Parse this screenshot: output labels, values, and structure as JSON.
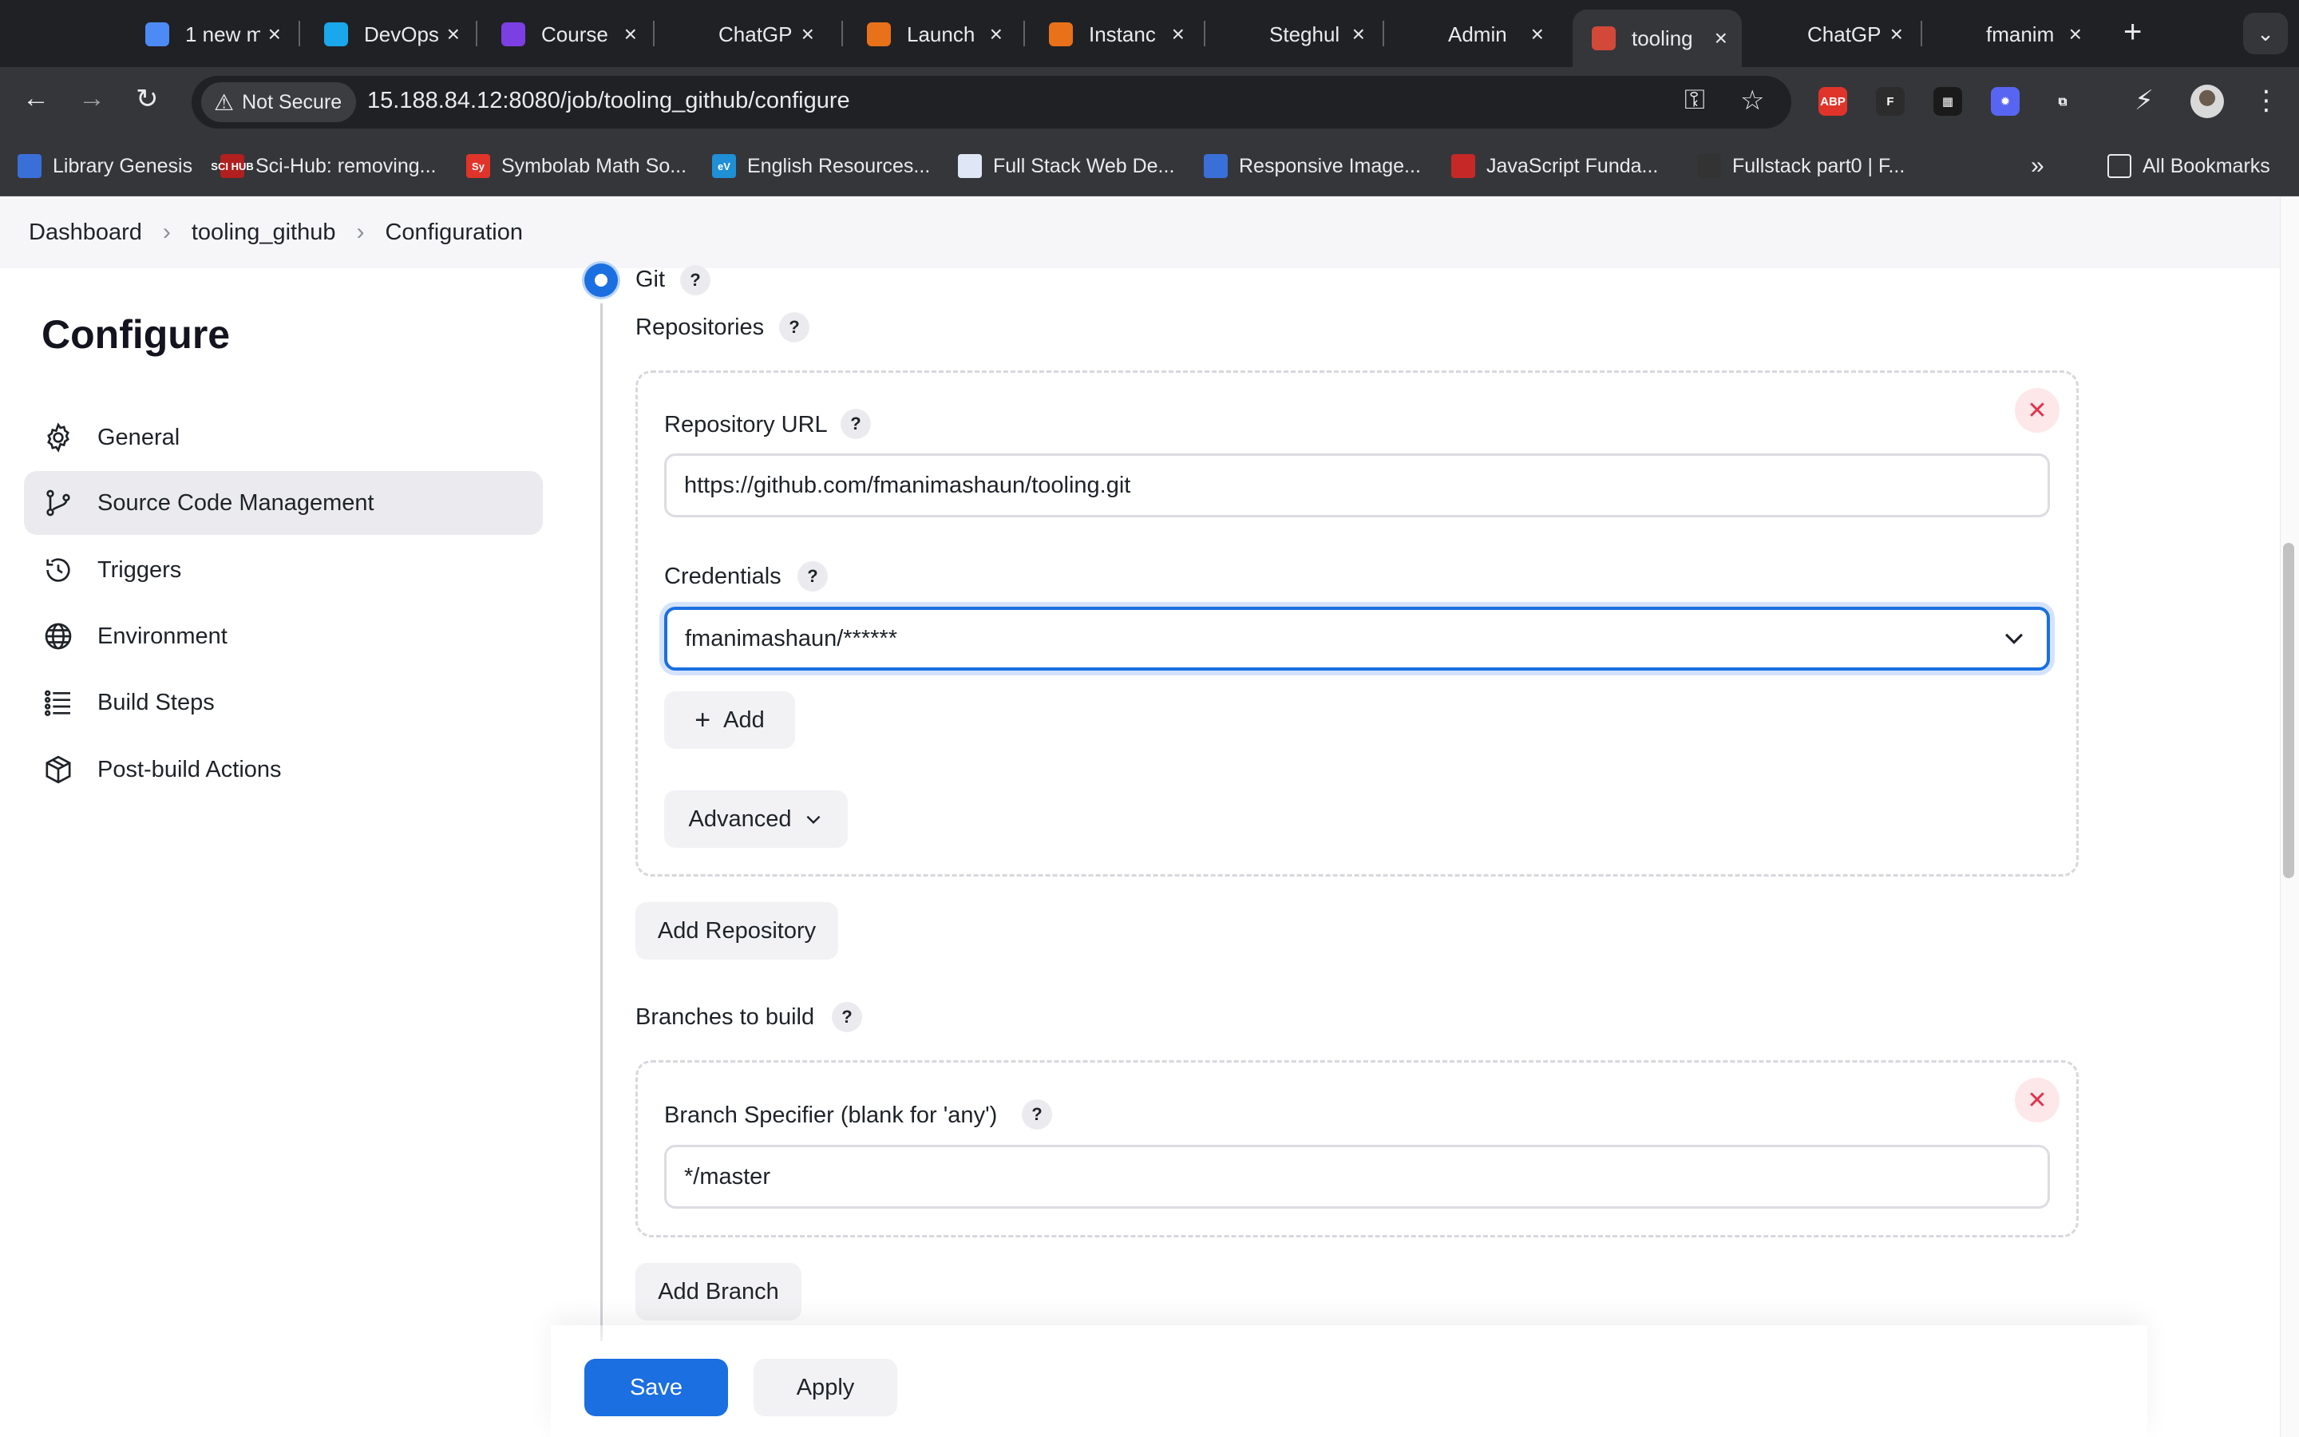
{
  "browser": {
    "tabs": [
      {
        "label": "1 new m",
        "icon": "mail-icon",
        "color": "#4c8bf5"
      },
      {
        "label": "DevOps",
        "icon": "devops-icon",
        "color": "#1aa7ec"
      },
      {
        "label": "Course",
        "icon": "shield-icon",
        "color": "#7b3fe4"
      },
      {
        "label": "ChatGP",
        "icon": "openai-icon",
        "color": "#202124"
      },
      {
        "label": "Launch",
        "icon": "aws-icon",
        "color": "#e8711a"
      },
      {
        "label": "Instanc",
        "icon": "aws-icon",
        "color": "#e8711a"
      },
      {
        "label": "Steghul",
        "icon": "github-icon",
        "color": "#202124"
      },
      {
        "label": "Admin",
        "icon": "globe-icon",
        "color": "#202124"
      },
      {
        "label": "tooling",
        "icon": "jenkins-icon",
        "color": "#d24939",
        "active": true
      },
      {
        "label": "ChatGP",
        "icon": "openai-icon",
        "color": "#202124"
      },
      {
        "label": "fmanim",
        "icon": "github-icon",
        "color": "#202124"
      }
    ],
    "new_tab": "+",
    "security_label": "Not Secure",
    "url": "15.188.84.12:8080/job/tooling_github/configure",
    "bookmarks": [
      {
        "label": "Library Genesis",
        "color": "#3b6fd8"
      },
      {
        "label": "Sci-Hub: removing...",
        "color": "#b11f1f",
        "badge": "SCI HUB"
      },
      {
        "label": "Symbolab Math So...",
        "color": "#e0342a",
        "badge": "Sy"
      },
      {
        "label": "English Resources...",
        "color": "#1f8fd6",
        "badge": "eV"
      },
      {
        "label": "Full Stack Web De...",
        "color": "#dfe6f5"
      },
      {
        "label": "Responsive Image...",
        "color": "#3b6fd8"
      },
      {
        "label": "JavaScript Funda...",
        "color": "#c62828"
      },
      {
        "label": "Fullstack part0 | F...",
        "color": "#333333"
      }
    ],
    "all_bookmarks": "All Bookmarks",
    "extensions": [
      {
        "name": "adblock-icon",
        "text": "ABP",
        "color": "#e0342a"
      },
      {
        "name": "figma-icon",
        "text": "F",
        "color": "#2c2c2c"
      },
      {
        "name": "colorzilla-icon",
        "text": "▦",
        "color": "#1a1a1a"
      },
      {
        "name": "sparkle-icon",
        "text": "✹",
        "color": "#5865f2"
      },
      {
        "name": "puzzle-icon",
        "text": "⧉",
        "color": "#35363a"
      }
    ]
  },
  "breadcrumb": {
    "items": [
      "Dashboard",
      "tooling_github",
      "Configuration"
    ]
  },
  "sidebar": {
    "title": "Configure",
    "items": [
      {
        "label": "General",
        "icon": "gear-icon"
      },
      {
        "label": "Source Code Management",
        "icon": "git-branch-icon",
        "active": true
      },
      {
        "label": "Triggers",
        "icon": "clock-icon"
      },
      {
        "label": "Environment",
        "icon": "globe-icon"
      },
      {
        "label": "Build Steps",
        "icon": "list-icon"
      },
      {
        "label": "Post-build Actions",
        "icon": "package-icon"
      }
    ]
  },
  "scm": {
    "git_label": "Git",
    "repositories_label": "Repositories",
    "repo_url_label": "Repository URL",
    "repo_url_value": "https://github.com/fmanimashaun/tooling.git",
    "credentials_label": "Credentials",
    "credentials_value": "fmanimashaun/******",
    "add_label": "Add",
    "advanced_label": "Advanced",
    "add_repository_label": "Add Repository",
    "branches_label": "Branches to build",
    "branch_spec_label": "Branch Specifier (blank for 'any')",
    "branch_spec_value": "*/master",
    "add_branch_label": "Add Branch",
    "help": "?"
  },
  "footer": {
    "save_label": "Save",
    "apply_label": "Apply"
  },
  "colors": {
    "accent": "#1b6fe0",
    "danger": "#e0334d"
  }
}
